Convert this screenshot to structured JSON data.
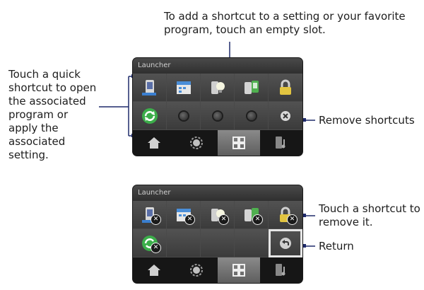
{
  "annotations": {
    "add_shortcut": "To add a shortcut to a setting or your favorite program, touch an empty slot.",
    "quick_shortcut": "Touch a quick shortcut to open the associated program or apply the associated setting.",
    "remove_shortcuts": "Remove shortcuts",
    "touch_to_remove": "Touch a shortcut to remove it.",
    "return": "Return"
  },
  "launcher_top": {
    "title": "Launcher",
    "row1": [
      "phone-icon",
      "calendar-icon",
      "bulb-icon",
      "connection-icon",
      "lock-icon"
    ],
    "row2": [
      "sync-icon",
      "empty-slot",
      "empty-slot",
      "empty-slot",
      "remove-shortcuts-icon"
    ]
  },
  "launcher_bottom": {
    "title": "Launcher",
    "row1": [
      "phone-icon",
      "calendar-icon",
      "bulb-icon",
      "connection-icon",
      "lock-icon"
    ],
    "row2": [
      "sync-icon",
      "blank",
      "blank",
      "blank",
      "return-icon"
    ]
  },
  "tabs": [
    "home-icon",
    "settings-icon",
    "launcher-icon",
    "music-icon"
  ],
  "colors": {
    "panel": "#2b2b2b",
    "callout_line": "#1f2a6b",
    "sync_green": "#3cae4a"
  }
}
